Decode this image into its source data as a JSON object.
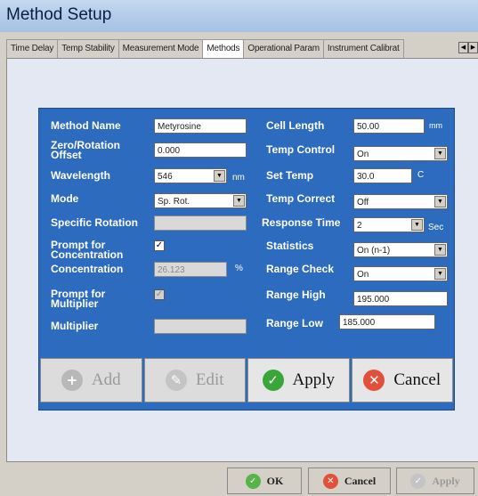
{
  "window": {
    "title": "Method Setup"
  },
  "tabs": [
    {
      "label": "Time Delay"
    },
    {
      "label": "Temp Stability"
    },
    {
      "label": "Measurement Mode"
    },
    {
      "label": "Methods"
    },
    {
      "label": "Operational Param"
    },
    {
      "label": "Instrument Calibrat"
    }
  ],
  "form": {
    "method_name": {
      "label": "Method Name",
      "value": "Metyrosine"
    },
    "zero_rotation_offset": {
      "label_line1": "Zero/Rotation",
      "label_line2": "Offset",
      "value": "0.000"
    },
    "wavelength": {
      "label": "Wavelength",
      "value": "546",
      "unit": "nm"
    },
    "mode": {
      "label": "Mode",
      "value": "Sp. Rot."
    },
    "specific_rotation": {
      "label": "Specific Rotation",
      "value": ""
    },
    "prompt_concentration": {
      "label_line1": "Prompt for",
      "label_line2": "Concentration",
      "check": "✓"
    },
    "concentration": {
      "label": "Concentration",
      "value": "26.123",
      "unit": "%"
    },
    "prompt_multiplier": {
      "label_line1": "Prompt for",
      "label_line2": "Multiplier",
      "check": "✓"
    },
    "multiplier": {
      "label": "Multiplier",
      "value": ""
    },
    "cell_length": {
      "label": "Cell Length",
      "value": "50.00",
      "unit": "mm"
    },
    "temp_control": {
      "label": "Temp Control",
      "value": "On"
    },
    "set_temp": {
      "label": "Set Temp",
      "value": "30.0",
      "unit": "C"
    },
    "temp_correct": {
      "label": "Temp Correct",
      "value": "Off"
    },
    "response_time": {
      "label": "Response Time",
      "value": "2",
      "unit": "Sec"
    },
    "statistics": {
      "label": "Statistics",
      "value": "On (n-1)"
    },
    "range_check": {
      "label": "Range Check",
      "value": "On"
    },
    "range_high": {
      "label": "Range High",
      "value": "195.000"
    },
    "range_low": {
      "label": "Range Low",
      "value": "185.000"
    }
  },
  "actions": {
    "add": "Add",
    "edit": "Edit",
    "apply": "Apply",
    "cancel": "Cancel"
  },
  "footer": {
    "ok": "OK",
    "cancel": "Cancel",
    "apply": "Apply"
  },
  "icons": {
    "dropdown": "▼",
    "scroll_left": "◀",
    "scroll_right": "▶",
    "plus": "+",
    "pencil": "✎",
    "check": "✓",
    "close": "✕"
  },
  "colors": {
    "panel": "#2d6bbf",
    "titlebar": "#a4c0e3",
    "apply_green": "#3aa63a",
    "cancel_red": "#e0503a"
  }
}
